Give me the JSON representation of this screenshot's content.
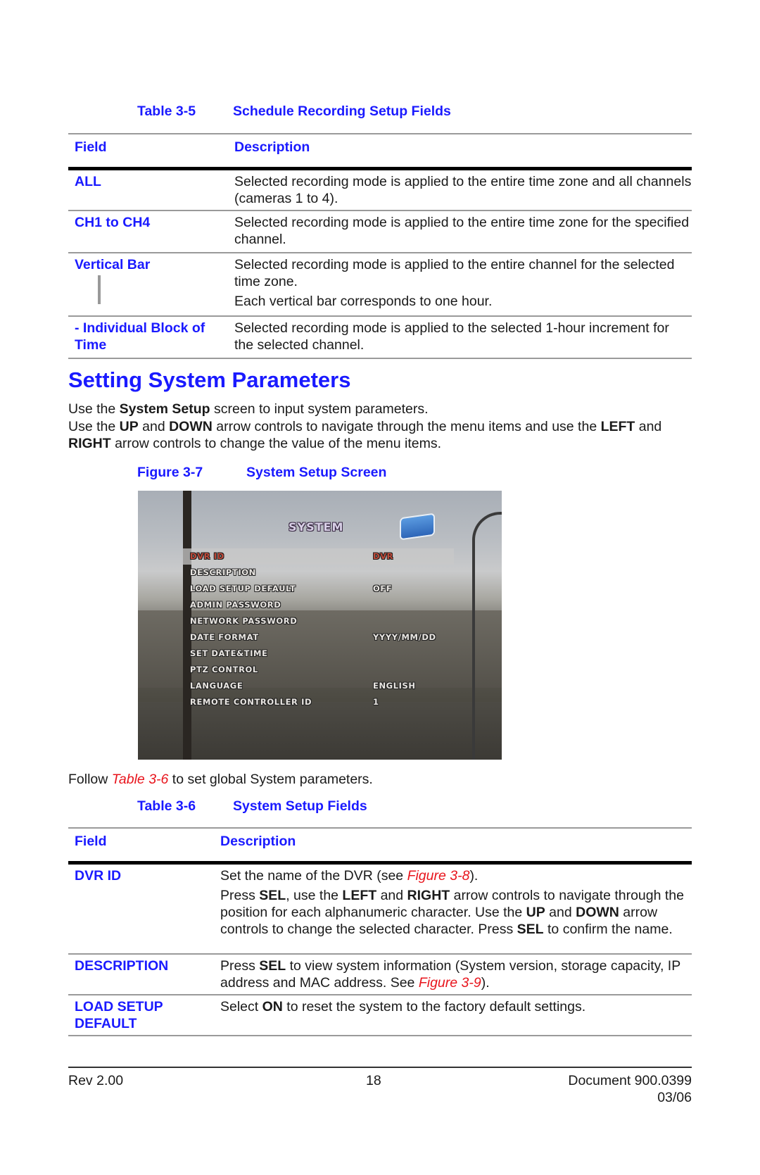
{
  "table35": {
    "number": "Table 3-5",
    "title": "Schedule Recording Setup Fields",
    "col_field": "Field",
    "col_description": "Description",
    "rows": [
      {
        "field": "ALL",
        "desc": [
          "Selected recording mode is applied to the entire time zone and all channels (cameras 1 to 4)."
        ]
      },
      {
        "field": "CH1 to CH4",
        "desc": [
          "Selected recording mode is applied to the entire time zone for the specified channel."
        ]
      },
      {
        "field": "Vertical Bar",
        "icon": "vertical-bar-icon",
        "desc": [
          "Selected recording mode is applied to the entire channel for the selected time zone.",
          "Each vertical bar corresponds to one hour."
        ]
      },
      {
        "field": "- Individual Block of Time",
        "desc": [
          "Selected recording mode is applied to the selected 1-hour increment for the selected channel."
        ]
      }
    ]
  },
  "section": {
    "title": "Setting System Parameters",
    "intro1_pre": "Use the ",
    "intro1_bold": "System Setup",
    "intro1_post": " screen to input system parameters.",
    "intro2": [
      {
        "t": "Use the ",
        "b": false
      },
      {
        "t": "UP",
        "b": true
      },
      {
        "t": " and ",
        "b": false
      },
      {
        "t": "DOWN",
        "b": true
      },
      {
        "t": " arrow controls to navigate through the menu items and use the ",
        "b": false
      },
      {
        "t": "LEFT",
        "b": true
      },
      {
        "t": " and ",
        "b": false
      },
      {
        "t": "RIGHT",
        "b": true
      },
      {
        "t": " arrow controls to change the value of the menu items.",
        "b": false
      }
    ]
  },
  "figure37": {
    "number": "Figure 3-7",
    "title": "System Setup Screen",
    "screen_title": "SYSTEM",
    "menu": [
      {
        "label": "DVR ID",
        "value": "DVR",
        "selected": true
      },
      {
        "label": "DESCRIPTION",
        "value": ""
      },
      {
        "label": "LOAD SETUP DEFAULT",
        "value": "OFF"
      },
      {
        "label": "ADMIN PASSWORD",
        "value": ""
      },
      {
        "label": "NETWORK PASSWORD",
        "value": ""
      },
      {
        "label": "DATE FORMAT",
        "value": "YYYY/MM/DD"
      },
      {
        "label": "SET DATE&TIME",
        "value": ""
      },
      {
        "label": "PTZ CONTROL",
        "value": ""
      },
      {
        "label": "LANGUAGE",
        "value": "ENGLISH"
      },
      {
        "label": "REMOTE CONTROLLER ID",
        "value": "1"
      }
    ]
  },
  "follow": {
    "pre": "Follow ",
    "link": "Table 3-6",
    "post": " to set global System parameters."
  },
  "table36": {
    "number": "Table 3-6",
    "title": "System Setup Fields",
    "col_field": "Field",
    "col_description": "Description",
    "rows": [
      {
        "field": "DVR ID",
        "paras": [
          [
            {
              "t": "Set the name of the DVR (see "
            },
            {
              "t": "Figure 3-8",
              "link": true
            },
            {
              "t": ")."
            }
          ],
          [
            {
              "t": "Press "
            },
            {
              "t": "SEL",
              "b": true
            },
            {
              "t": ", use the "
            },
            {
              "t": "LEFT",
              "b": true
            },
            {
              "t": " and "
            },
            {
              "t": "RIGHT",
              "b": true
            },
            {
              "t": " arrow controls to navigate through the position for each alphanumeric character. Use the "
            },
            {
              "t": "UP",
              "b": true
            },
            {
              "t": " and "
            },
            {
              "t": "DOWN",
              "b": true
            },
            {
              "t": " arrow controls to change the selected character. Press "
            },
            {
              "t": "SEL",
              "b": true
            },
            {
              "t": " to confirm the name."
            }
          ]
        ]
      },
      {
        "field": "DESCRIPTION",
        "paras": [
          [
            {
              "t": "Press "
            },
            {
              "t": "SEL",
              "b": true
            },
            {
              "t": " to view system information (System version, storage capacity, IP address and MAC address. See "
            },
            {
              "t": "Figure 3-9",
              "link": true
            },
            {
              "t": ")."
            }
          ]
        ]
      },
      {
        "field": "LOAD SETUP DEFAULT",
        "paras": [
          [
            {
              "t": "Select "
            },
            {
              "t": "ON",
              "b": true
            },
            {
              "t": " to reset the system to the factory default settings."
            }
          ]
        ]
      }
    ]
  },
  "footer": {
    "rev": "Rev 2.00",
    "page": "18",
    "document": "Document 900.0399",
    "date": "03/06"
  }
}
